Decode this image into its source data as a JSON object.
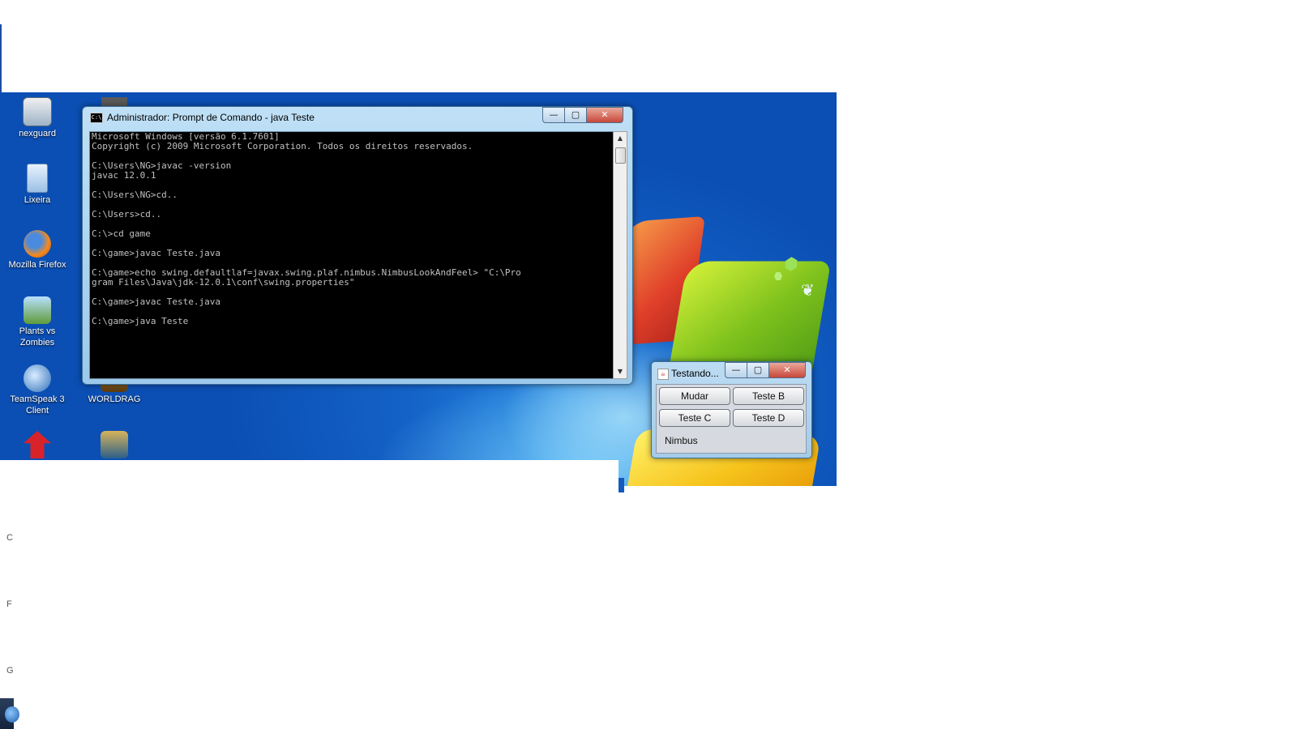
{
  "desktop": {
    "icons": [
      {
        "label": "nexguard",
        "icon": "lock-icon"
      },
      {
        "label": "Lixeira",
        "icon": "recycle-bin-icon"
      },
      {
        "label": "Mozilla Firefox",
        "icon": "firefox-icon"
      },
      {
        "label": "Plants vs Zombies",
        "icon": "plants-vs-zombies-icon"
      },
      {
        "label": "TeamSpeak 3 Client",
        "icon": "teamspeak-icon"
      },
      {
        "label": "WORLDRAG",
        "icon": "worldrag-icon"
      }
    ]
  },
  "cmd_window": {
    "title": "Administrador: Prompt de Comando - java  Teste",
    "icon_text": "C:\\",
    "buttons": {
      "minimize": "—",
      "maximize": "▢",
      "close": "✕"
    },
    "console_lines": [
      "Microsoft Windows [versão 6.1.7601]",
      "Copyright (c) 2009 Microsoft Corporation. Todos os direitos reservados.",
      "",
      "C:\\Users\\NG>javac -version",
      "javac 12.0.1",
      "",
      "C:\\Users\\NG>cd..",
      "",
      "C:\\Users>cd..",
      "",
      "C:\\>cd game",
      "",
      "C:\\game>javac Teste.java",
      "",
      "C:\\game>echo swing.defaultlaf=javax.swing.plaf.nimbus.NimbusLookAndFeel> \"C:\\Pro",
      "gram Files\\Java\\jdk-12.0.1\\conf\\swing.properties\"",
      "",
      "C:\\game>javac Teste.java",
      "",
      "C:\\game>java Teste"
    ]
  },
  "java_window": {
    "title": "Testando...",
    "buttons": {
      "minimize": "—",
      "maximize": "▢",
      "close": "✕"
    },
    "actions": {
      "mudar": "Mudar",
      "teste_b": "Teste B",
      "teste_c": "Teste C",
      "teste_d": "Teste D"
    },
    "laf_label": "Nimbus"
  },
  "left_fragments": [
    "C",
    "F",
    "G"
  ]
}
